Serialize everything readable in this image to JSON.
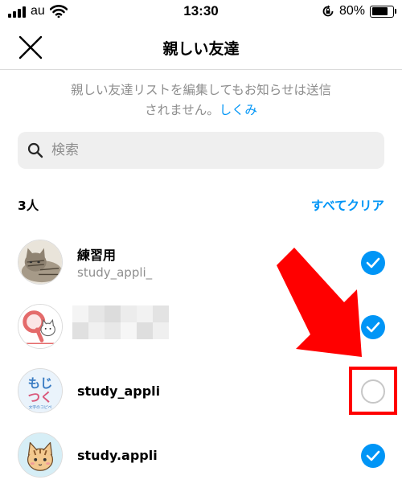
{
  "status_bar": {
    "carrier": "au",
    "time": "13:30",
    "battery": "80%"
  },
  "header": {
    "title": "親しい友達"
  },
  "notice": {
    "line1": "親しい友達リストを編集してもお知らせは送信",
    "line2": "されません。",
    "link": "しくみ"
  },
  "search": {
    "placeholder": "検索",
    "value": ""
  },
  "list": {
    "count_label": "3人",
    "clear_label": "すべてクリア",
    "items": [
      {
        "name": "練習用",
        "username": "study_appli_",
        "selected": true
      },
      {
        "name": "",
        "username": "",
        "selected": true
      },
      {
        "name": "study_appli",
        "username": "",
        "selected": false
      },
      {
        "name": "study.appli",
        "username": "",
        "selected": true
      }
    ]
  },
  "avatars": {
    "item3_text_top": "もじ",
    "item3_text_bottom": "つく",
    "item3_caption": "文字のコピペ"
  },
  "colors": {
    "accent": "#0095f6",
    "annotation": "#ff0000",
    "muted": "#8e8e8e"
  },
  "icons": [
    "signal-icon",
    "wifi-icon",
    "orientation-lock-icon",
    "battery-icon",
    "close-icon",
    "search-icon",
    "check-icon",
    "arrow-annotation"
  ]
}
